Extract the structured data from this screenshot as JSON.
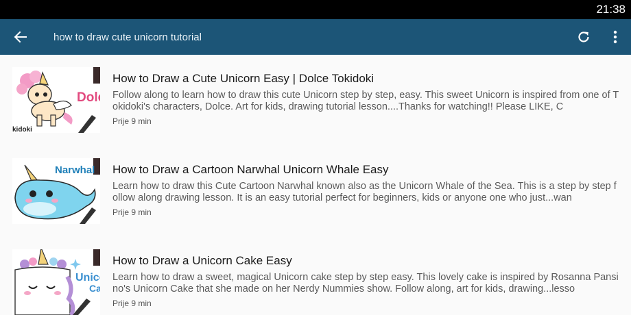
{
  "status": {
    "time": "21:38"
  },
  "appbar": {
    "back_icon": "arrow-left-icon",
    "query": "how to draw cute unicorn tutorial",
    "refresh_icon": "refresh-icon",
    "menu_icon": "more-vert-icon"
  },
  "results": [
    {
      "title": "How to Draw a Cute Unicorn Easy | Dolce Tokidoki",
      "description": "Follow along to learn how to draw this cute Unicorn step by step, easy. This sweet Unicorn is inspired from one of Tokidoki's characters, Dolce. Art for kids, drawing tutorial lesson....Thanks for watching!! Please LIKE, C",
      "time": "Prije 9 min",
      "thumb_text": "Dolc",
      "thumb_sub": "kidoki"
    },
    {
      "title": "How to Draw a Cartoon Narwhal Unicorn Whale Easy",
      "description": "Learn how to draw this Cute Cartoon Narwhal known also as the Unicorn Whale of the Sea. This is a step by step follow along drawing lesson. It is an easy tutorial perfect for beginners, kids or anyone one who just...wan",
      "time": "Prije 9 min",
      "thumb_text": "Narwhal"
    },
    {
      "title": "How to Draw a Unicorn Cake Easy",
      "description": "Learn how to draw a sweet, magical Unicorn cake step by step easy. This lovely cake is inspired by Rosanna Pansino's Unicorn Cake that she made on her Nerdy Nummies show. Follow along, art for kids, drawing...lesso",
      "time": "Prije 9 min",
      "thumb_text": "Unicor",
      "thumb_sub": "Ca"
    }
  ]
}
